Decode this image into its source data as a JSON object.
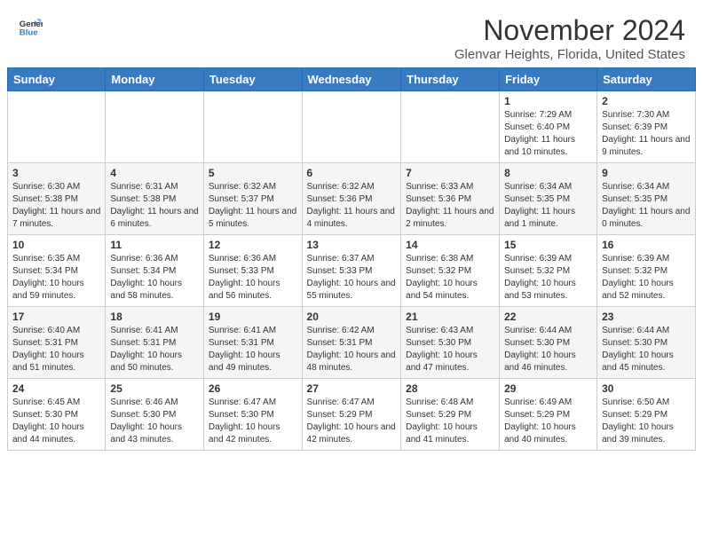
{
  "logo": {
    "line1": "General",
    "line2": "Blue"
  },
  "header": {
    "month": "November 2024",
    "location": "Glenvar Heights, Florida, United States"
  },
  "weekdays": [
    "Sunday",
    "Monday",
    "Tuesday",
    "Wednesday",
    "Thursday",
    "Friday",
    "Saturday"
  ],
  "weeks": [
    [
      {
        "day": "",
        "info": ""
      },
      {
        "day": "",
        "info": ""
      },
      {
        "day": "",
        "info": ""
      },
      {
        "day": "",
        "info": ""
      },
      {
        "day": "",
        "info": ""
      },
      {
        "day": "1",
        "info": "Sunrise: 7:29 AM\nSunset: 6:40 PM\nDaylight: 11 hours and 10 minutes."
      },
      {
        "day": "2",
        "info": "Sunrise: 7:30 AM\nSunset: 6:39 PM\nDaylight: 11 hours and 9 minutes."
      }
    ],
    [
      {
        "day": "3",
        "info": "Sunrise: 6:30 AM\nSunset: 5:38 PM\nDaylight: 11 hours and 7 minutes."
      },
      {
        "day": "4",
        "info": "Sunrise: 6:31 AM\nSunset: 5:38 PM\nDaylight: 11 hours and 6 minutes."
      },
      {
        "day": "5",
        "info": "Sunrise: 6:32 AM\nSunset: 5:37 PM\nDaylight: 11 hours and 5 minutes."
      },
      {
        "day": "6",
        "info": "Sunrise: 6:32 AM\nSunset: 5:36 PM\nDaylight: 11 hours and 4 minutes."
      },
      {
        "day": "7",
        "info": "Sunrise: 6:33 AM\nSunset: 5:36 PM\nDaylight: 11 hours and 2 minutes."
      },
      {
        "day": "8",
        "info": "Sunrise: 6:34 AM\nSunset: 5:35 PM\nDaylight: 11 hours and 1 minute."
      },
      {
        "day": "9",
        "info": "Sunrise: 6:34 AM\nSunset: 5:35 PM\nDaylight: 11 hours and 0 minutes."
      }
    ],
    [
      {
        "day": "10",
        "info": "Sunrise: 6:35 AM\nSunset: 5:34 PM\nDaylight: 10 hours and 59 minutes."
      },
      {
        "day": "11",
        "info": "Sunrise: 6:36 AM\nSunset: 5:34 PM\nDaylight: 10 hours and 58 minutes."
      },
      {
        "day": "12",
        "info": "Sunrise: 6:36 AM\nSunset: 5:33 PM\nDaylight: 10 hours and 56 minutes."
      },
      {
        "day": "13",
        "info": "Sunrise: 6:37 AM\nSunset: 5:33 PM\nDaylight: 10 hours and 55 minutes."
      },
      {
        "day": "14",
        "info": "Sunrise: 6:38 AM\nSunset: 5:32 PM\nDaylight: 10 hours and 54 minutes."
      },
      {
        "day": "15",
        "info": "Sunrise: 6:39 AM\nSunset: 5:32 PM\nDaylight: 10 hours and 53 minutes."
      },
      {
        "day": "16",
        "info": "Sunrise: 6:39 AM\nSunset: 5:32 PM\nDaylight: 10 hours and 52 minutes."
      }
    ],
    [
      {
        "day": "17",
        "info": "Sunrise: 6:40 AM\nSunset: 5:31 PM\nDaylight: 10 hours and 51 minutes."
      },
      {
        "day": "18",
        "info": "Sunrise: 6:41 AM\nSunset: 5:31 PM\nDaylight: 10 hours and 50 minutes."
      },
      {
        "day": "19",
        "info": "Sunrise: 6:41 AM\nSunset: 5:31 PM\nDaylight: 10 hours and 49 minutes."
      },
      {
        "day": "20",
        "info": "Sunrise: 6:42 AM\nSunset: 5:31 PM\nDaylight: 10 hours and 48 minutes."
      },
      {
        "day": "21",
        "info": "Sunrise: 6:43 AM\nSunset: 5:30 PM\nDaylight: 10 hours and 47 minutes."
      },
      {
        "day": "22",
        "info": "Sunrise: 6:44 AM\nSunset: 5:30 PM\nDaylight: 10 hours and 46 minutes."
      },
      {
        "day": "23",
        "info": "Sunrise: 6:44 AM\nSunset: 5:30 PM\nDaylight: 10 hours and 45 minutes."
      }
    ],
    [
      {
        "day": "24",
        "info": "Sunrise: 6:45 AM\nSunset: 5:30 PM\nDaylight: 10 hours and 44 minutes."
      },
      {
        "day": "25",
        "info": "Sunrise: 6:46 AM\nSunset: 5:30 PM\nDaylight: 10 hours and 43 minutes."
      },
      {
        "day": "26",
        "info": "Sunrise: 6:47 AM\nSunset: 5:30 PM\nDaylight: 10 hours and 42 minutes."
      },
      {
        "day": "27",
        "info": "Sunrise: 6:47 AM\nSunset: 5:29 PM\nDaylight: 10 hours and 42 minutes."
      },
      {
        "day": "28",
        "info": "Sunrise: 6:48 AM\nSunset: 5:29 PM\nDaylight: 10 hours and 41 minutes."
      },
      {
        "day": "29",
        "info": "Sunrise: 6:49 AM\nSunset: 5:29 PM\nDaylight: 10 hours and 40 minutes."
      },
      {
        "day": "30",
        "info": "Sunrise: 6:50 AM\nSunset: 5:29 PM\nDaylight: 10 hours and 39 minutes."
      }
    ]
  ]
}
